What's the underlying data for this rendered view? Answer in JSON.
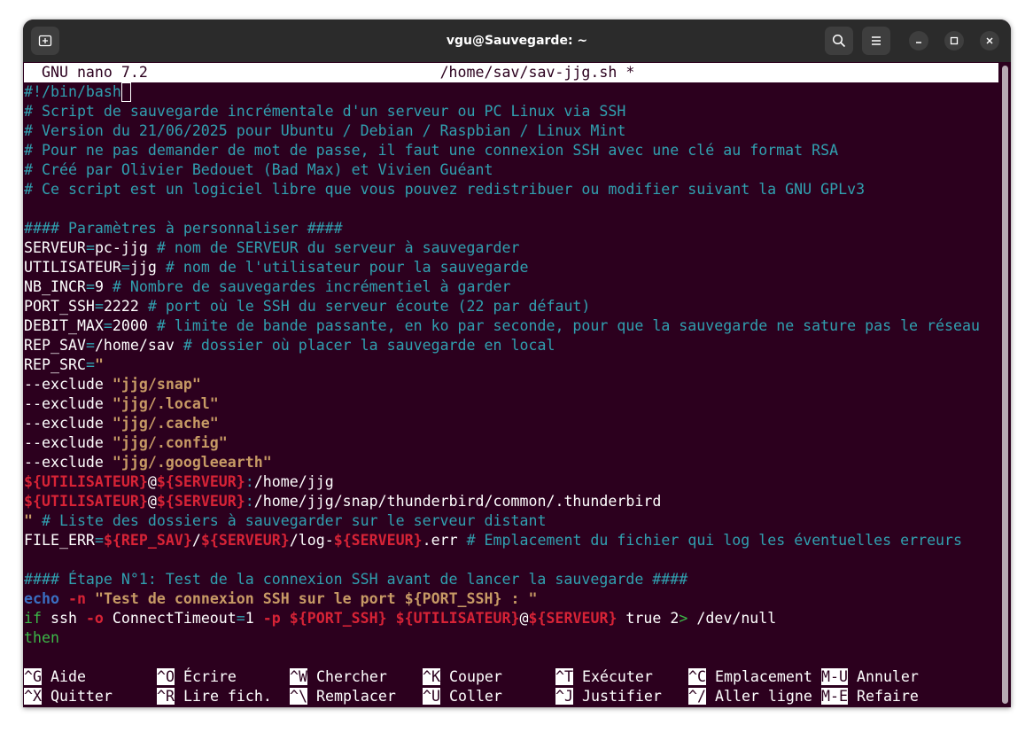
{
  "window": {
    "title": "vgu@Sauvegarde: ~"
  },
  "titlebar_icons": [
    "new-tab-icon",
    "search-icon",
    "menu-icon",
    "minimize-icon",
    "maximize-icon",
    "close-icon"
  ],
  "nano": {
    "header_left": "GNU nano 7.2",
    "header_file": "/home/sav/sav-jjg.sh *",
    "lines": [
      "#!/bin/bash",
      "# Script de sauvegarde incrémentale d'un serveur ou PC Linux via SSH",
      "# Version du 21/06/2025 pour Ubuntu / Debian / Raspbian / Linux Mint",
      "# Pour ne pas demander de mot de passe, il faut une connexion SSH avec une clé au format RSA",
      "# Créé par Olivier Bedouet (Bad Max) et Vivien Guéant",
      "# Ce script est un logiciel libre que vous pouvez redistribuer ou modifier suivant la GNU GPLv3",
      "",
      "#### Paramètres à personnaliser ####",
      "SERVEUR=pc-jjg # nom de SERVEUR du serveur à sauvegarder",
      "UTILISATEUR=jjg # nom de l'utilisateur pour la sauvegarde",
      "NB_INCR=9 # Nombre de sauvegardes incrémentiel à garder",
      "PORT_SSH=2222 # port où le SSH du serveur écoute (22 par défaut)",
      "DEBIT_MAX=2000 # limite de bande passante, en ko par seconde, pour que la sauvegarde ne sature pas le réseau",
      "REP_SAV=/home/sav # dossier où placer la sauvegarde en local",
      "REP_SRC=\"",
      "--exclude \"jjg/snap\"",
      "--exclude \"jjg/.local\"",
      "--exclude \"jjg/.cache\"",
      "--exclude \"jjg/.config\"",
      "--exclude \"jjg/.googleearth\"",
      "${UTILISATEUR}@${SERVEUR}:/home/jjg",
      "${UTILISATEUR}@${SERVEUR}:/home/jjg/snap/thunderbird/common/.thunderbird",
      "\" # Liste des dossiers à sauvegarder sur le serveur distant",
      "FILE_ERR=${REP_SAV}/${SERVEUR}/log-${SERVEUR}.err # Emplacement du fichier qui log les éventuelles erreurs",
      "",
      "#### Étape N°1: Test de la connexion SSH avant de lancer la sauvegarde ####",
      "echo -n \"Test de connexion SSH sur le port ${PORT_SSH} : \"",
      "if ssh -o ConnectTimeout=1 -p ${PORT_SSH} ${UTILISATEUR}@${SERVEUR} true 2> /dev/null",
      "then"
    ],
    "shortcuts_row1": [
      {
        "key": "^G",
        "label": "Aide"
      },
      {
        "key": "^O",
        "label": "Écrire"
      },
      {
        "key": "^W",
        "label": "Chercher"
      },
      {
        "key": "^K",
        "label": "Couper"
      },
      {
        "key": "^T",
        "label": "Exécuter"
      },
      {
        "key": "^C",
        "label": "Emplacement"
      },
      {
        "key": "M-U",
        "label": "Annuler"
      }
    ],
    "shortcuts_row2": [
      {
        "key": "^X",
        "label": "Quitter"
      },
      {
        "key": "^R",
        "label": "Lire fich."
      },
      {
        "key": "^\\",
        "label": "Remplacer"
      },
      {
        "key": "^U",
        "label": "Coller"
      },
      {
        "key": "^J",
        "label": "Justifier"
      },
      {
        "key": "^/",
        "label": "Aller ligne"
      },
      {
        "key": "M-E",
        "label": "Refaire"
      }
    ]
  },
  "colors": {
    "background": "#2c001e",
    "comment": "#30a0b0",
    "string": "#c79a65",
    "variable": "#d72336",
    "keyword": "#3a6fc2",
    "green": "#3cb848"
  }
}
